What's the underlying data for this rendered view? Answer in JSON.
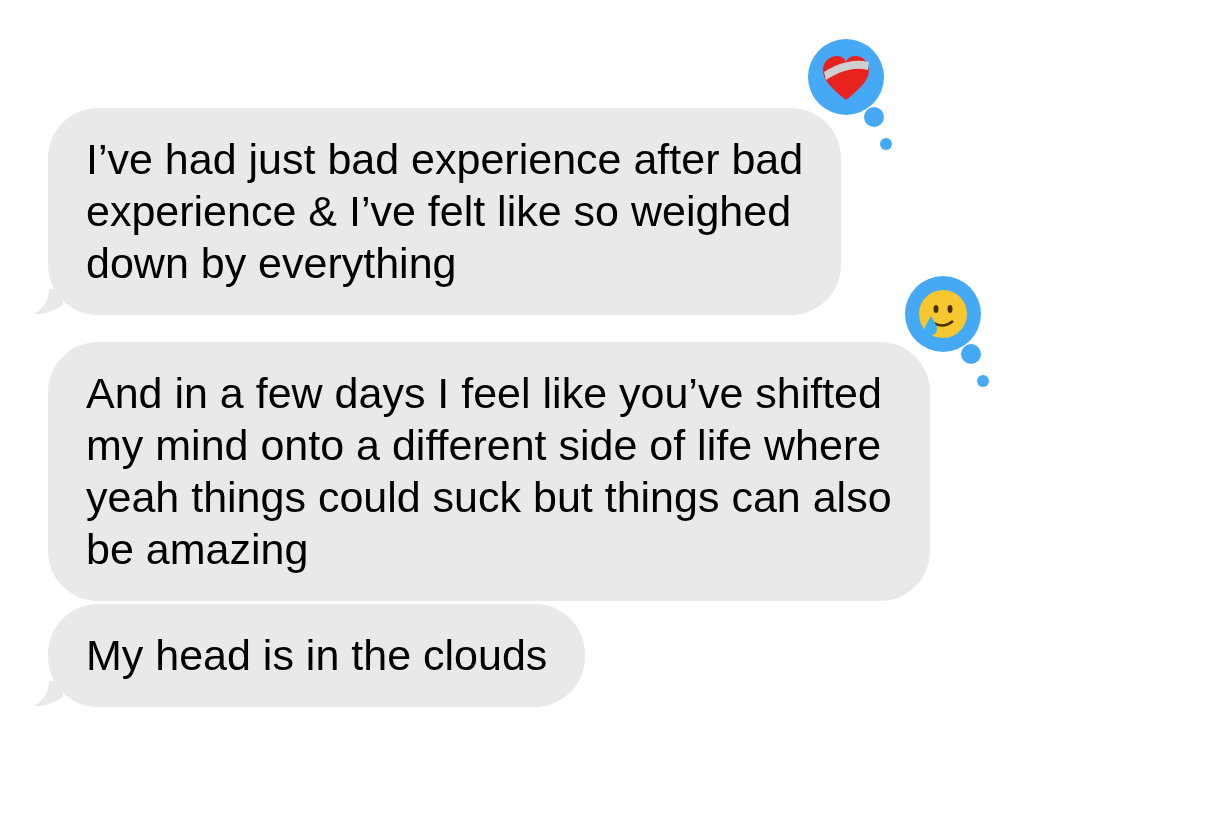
{
  "messages": [
    {
      "text": "I’ve had just bad experience after bad\nexperience & I’ve felt like so weighed\ndown by everything",
      "tail": true,
      "reaction": {
        "kind": "mending_heart"
      }
    },
    {
      "text": "And in a few days I feel like you’ve shifted\nmy mind onto a different side of life where\nyeah things could suck but things can also\nbe amazing",
      "tail": false,
      "reaction": {
        "kind": "tear_smile"
      }
    },
    {
      "text": "My head is in the clouds",
      "tail": true
    }
  ]
}
